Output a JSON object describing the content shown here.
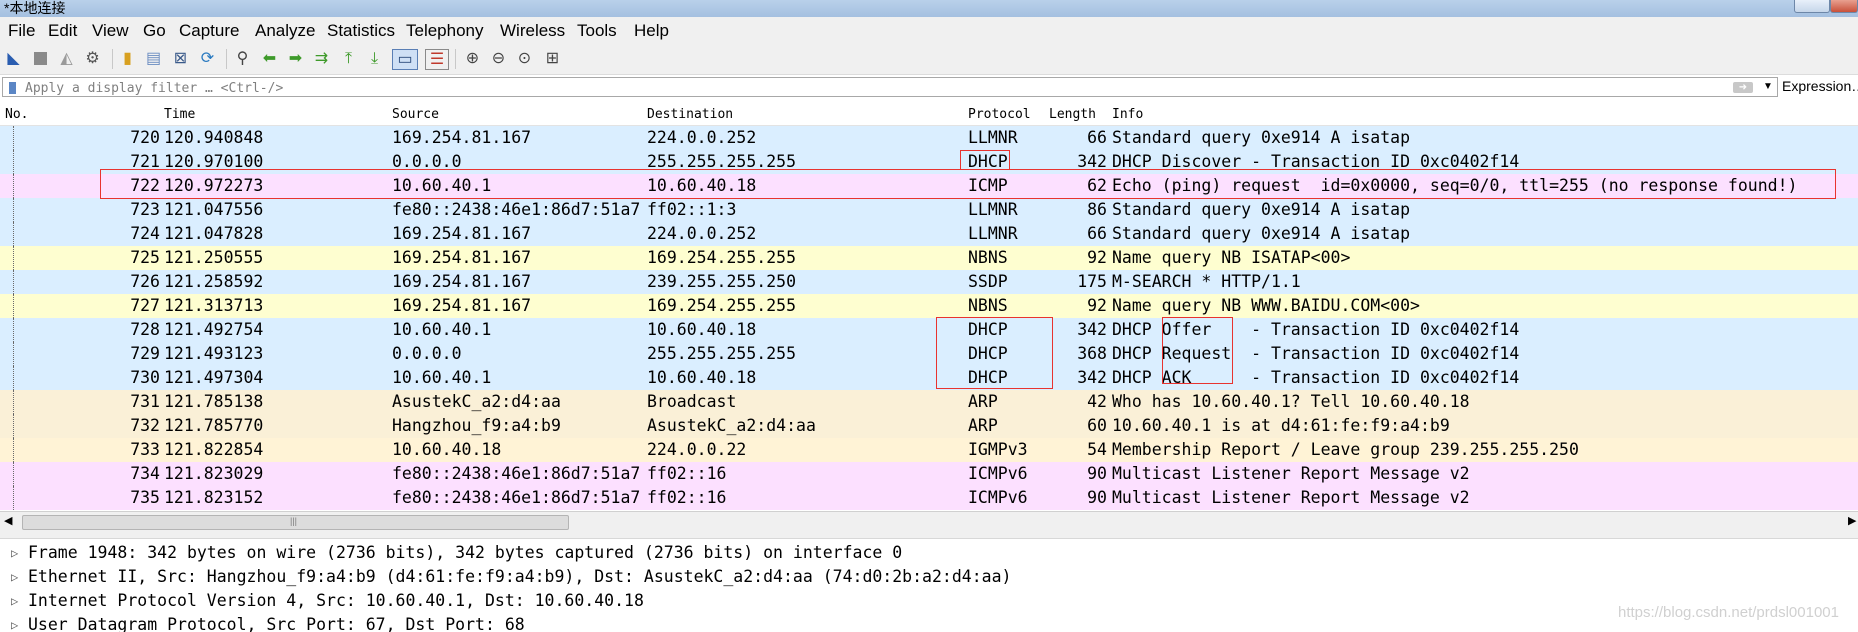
{
  "window": {
    "title": "*本地连接"
  },
  "menu": [
    "File",
    "Edit",
    "View",
    "Go",
    "Capture",
    "Analyze",
    "Statistics",
    "Telephony",
    "Wireless",
    "Tools",
    "Help"
  ],
  "toolbar": {
    "icons": [
      "shark-fin-start-icon",
      "stop-icon",
      "restart-icon",
      "capture-options-icon",
      "open-file-icon",
      "save-file-icon",
      "close-file-icon",
      "reload-icon",
      "find-packet-icon",
      "go-back-icon",
      "go-forward-icon",
      "go-to-packet-icon",
      "go-first-icon",
      "go-last-icon",
      "autoscroll-icon",
      "colorize-icon",
      "zoom-in-icon",
      "zoom-out-icon",
      "zoom-normal-icon",
      "resize-columns-icon"
    ]
  },
  "filter": {
    "placeholder": "Apply a display filter … <Ctrl-/>",
    "expression_label": "Expression…"
  },
  "columns": [
    "No.",
    "Time",
    "Source",
    "Destination",
    "Protocol",
    "Length",
    "Info"
  ],
  "packets": [
    {
      "no": "720",
      "time": "120.940848",
      "src": "169.254.81.167",
      "dst": "224.0.0.252",
      "proto": "LLMNR",
      "len": "66",
      "info": "Standard query 0xe914 A isatap",
      "bg": "#daeeff"
    },
    {
      "no": "721",
      "time": "120.970100",
      "src": "0.0.0.0",
      "dst": "255.255.255.255",
      "proto": "DHCP",
      "len": "342",
      "info": "DHCP Discover - Transaction ID 0xc0402f14",
      "bg": "#daeeff"
    },
    {
      "no": "722",
      "time": "120.972273",
      "src": "10.60.40.1",
      "dst": "10.60.40.18",
      "proto": "ICMP",
      "len": "62",
      "info": "Echo (ping) request  id=0x0000, seq=0/0, ttl=255 (no response found!)",
      "bg": "#fce0ff"
    },
    {
      "no": "723",
      "time": "121.047556",
      "src": "fe80::2438:46e1:86d7:51a7",
      "dst": "ff02::1:3",
      "proto": "LLMNR",
      "len": "86",
      "info": "Standard query 0xe914 A isatap",
      "bg": "#daeeff"
    },
    {
      "no": "724",
      "time": "121.047828",
      "src": "169.254.81.167",
      "dst": "224.0.0.252",
      "proto": "LLMNR",
      "len": "66",
      "info": "Standard query 0xe914 A isatap",
      "bg": "#daeeff"
    },
    {
      "no": "725",
      "time": "121.250555",
      "src": "169.254.81.167",
      "dst": "169.254.255.255",
      "proto": "NBNS",
      "len": "92",
      "info": "Name query NB ISATAP<00>",
      "bg": "#fefed0"
    },
    {
      "no": "726",
      "time": "121.258592",
      "src": "169.254.81.167",
      "dst": "239.255.255.250",
      "proto": "SSDP",
      "len": "175",
      "info": "M-SEARCH * HTTP/1.1",
      "bg": "#daeeff"
    },
    {
      "no": "727",
      "time": "121.313713",
      "src": "169.254.81.167",
      "dst": "169.254.255.255",
      "proto": "NBNS",
      "len": "92",
      "info": "Name query NB WWW.BAIDU.COM<00>",
      "bg": "#fefed0"
    },
    {
      "no": "728",
      "time": "121.492754",
      "src": "10.60.40.1",
      "dst": "10.60.40.18",
      "proto": "DHCP",
      "len": "342",
      "info": "DHCP Offer    - Transaction ID 0xc0402f14",
      "bg": "#daeeff"
    },
    {
      "no": "729",
      "time": "121.493123",
      "src": "0.0.0.0",
      "dst": "255.255.255.255",
      "proto": "DHCP",
      "len": "368",
      "info": "DHCP Request  - Transaction ID 0xc0402f14",
      "bg": "#daeeff"
    },
    {
      "no": "730",
      "time": "121.497304",
      "src": "10.60.40.1",
      "dst": "10.60.40.18",
      "proto": "DHCP",
      "len": "342",
      "info": "DHCP ACK      - Transaction ID 0xc0402f14",
      "bg": "#daeeff"
    },
    {
      "no": "731",
      "time": "121.785138",
      "src": "AsustekC_a2:d4:aa",
      "dst": "Broadcast",
      "proto": "ARP",
      "len": "42",
      "info": "Who has 10.60.40.1? Tell 10.60.40.18",
      "bg": "#faf0d7"
    },
    {
      "no": "732",
      "time": "121.785770",
      "src": "Hangzhou_f9:a4:b9",
      "dst": "AsustekC_a2:d4:aa",
      "proto": "ARP",
      "len": "60",
      "info": "10.60.40.1 is at d4:61:fe:f9:a4:b9",
      "bg": "#faf0d7"
    },
    {
      "no": "733",
      "time": "121.822854",
      "src": "10.60.40.18",
      "dst": "224.0.0.22",
      "proto": "IGMPv3",
      "len": "54",
      "info": "Membership Report / Leave group 239.255.255.250",
      "bg": "#fff3d6"
    },
    {
      "no": "734",
      "time": "121.823029",
      "src": "fe80::2438:46e1:86d7:51a7",
      "dst": "ff02::16",
      "proto": "ICMPv6",
      "len": "90",
      "info": "Multicast Listener Report Message v2",
      "bg": "#fce0ff"
    },
    {
      "no": "735",
      "time": "121.823152",
      "src": "fe80::2438:46e1:86d7:51a7",
      "dst": "ff02::16",
      "proto": "ICMPv6",
      "len": "90",
      "info": "Multicast Listener Report Message v2",
      "bg": "#fce0ff"
    }
  ],
  "details": [
    "Frame 1948: 342 bytes on wire (2736 bits), 342 bytes captured (2736 bits) on interface 0",
    "Ethernet II, Src: Hangzhou_f9:a4:b9 (d4:61:fe:f9:a4:b9), Dst: AsustekC_a2:d4:aa (74:d0:2b:a2:d4:aa)",
    "Internet Protocol Version 4, Src: 10.60.40.1, Dst: 10.60.40.18",
    "User Datagram Protocol, Src Port: 67, Dst Port: 68"
  ],
  "watermark": "https://blog.csdn.net/prdsl001001",
  "colors": {
    "annotation_red": "#e8332f",
    "udp_blue": "#daeeff",
    "icmp_pink": "#fce0ff",
    "arp_tan": "#faf0d7",
    "nbns_yellow": "#fefed0"
  }
}
